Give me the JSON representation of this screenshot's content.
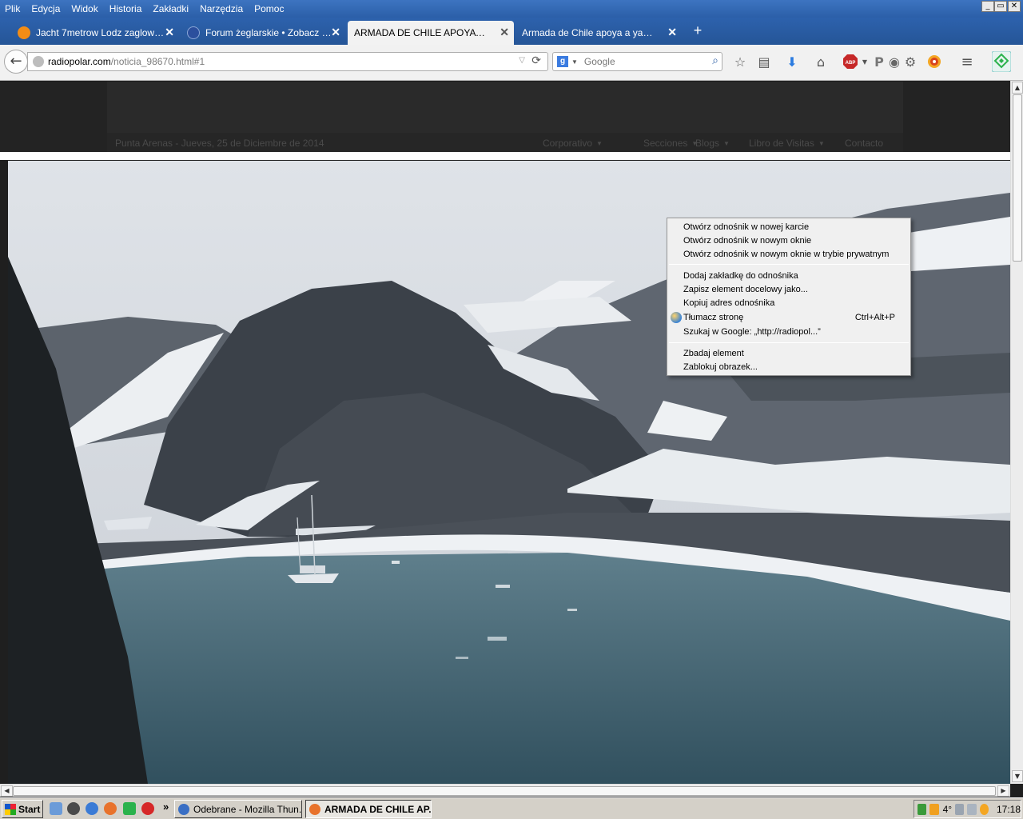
{
  "menubar": {
    "items": [
      "Plik",
      "Edycja",
      "Widok",
      "Historia",
      "Zakładki",
      "Narzędzia",
      "Pomoc"
    ],
    "window_controls": [
      "_",
      "▭",
      "✕"
    ]
  },
  "tabs": [
    {
      "label": "Jacht 7metrow Lodz zaglowka...",
      "color": "#f28c16"
    },
    {
      "label": "Forum żeglarskie • Zobacz wą...",
      "color": "#2b4f9d"
    },
    {
      "label": "ARMADA DE CHILE APOYA A YAT...",
      "color": "#f2f2f2"
    },
    {
      "label": "Armada de Chile apoya a yate pol...",
      "color": "#2d62ad"
    }
  ],
  "tab_close_glyph": "✕",
  "newtab_glyph": "+",
  "navbar": {
    "back_glyph": "←",
    "url_host": "radiopolar.com",
    "url_path": "/noticia_98670.html#1",
    "search_engine_letter": "g",
    "search_placeholder": "Google",
    "icons": [
      "star-icon",
      "reading-list-icon",
      "download-icon",
      "home-icon",
      "adblock-icon",
      "pinterest-icon",
      "extension-icon",
      "gear-icon",
      "firefox-sync-icon",
      "menu-icon",
      "feedly-icon"
    ]
  },
  "site": {
    "date": "Punta Arenas - Jueves, 25 de Diciembre de 2014",
    "nav": [
      "Corporativo",
      "Secciones",
      "Blogs",
      "Libro de Visitas",
      "Contacto"
    ]
  },
  "context_menu": {
    "group1": [
      "Otwórz odnośnik w nowej karcie",
      "Otwórz odnośnik w nowym oknie",
      "Otwórz odnośnik w nowym oknie w trybie prywatnym"
    ],
    "group2": [
      "Dodaj zakładkę do odnośnika",
      "Zapisz element docelowy jako...",
      "Kopiuj adres odnośnika",
      "Tłumacz stronę",
      "Szukaj w Google: „http://radiopol...”"
    ],
    "translate_shortcut": "Ctrl+Alt+P",
    "group3": [
      "Zbadaj element",
      "Zablokuj obrazek..."
    ]
  },
  "taskbar": {
    "start_label": "Start",
    "more_glyph": "»",
    "windows": [
      {
        "label": "Odebrane - Mozilla Thun...",
        "color": "#3a6fc4"
      },
      {
        "label": "ARMADA DE CHILE AP...",
        "color": "#e8722b"
      }
    ],
    "tray": {
      "temperature": "4°",
      "clock": "17:18"
    }
  }
}
